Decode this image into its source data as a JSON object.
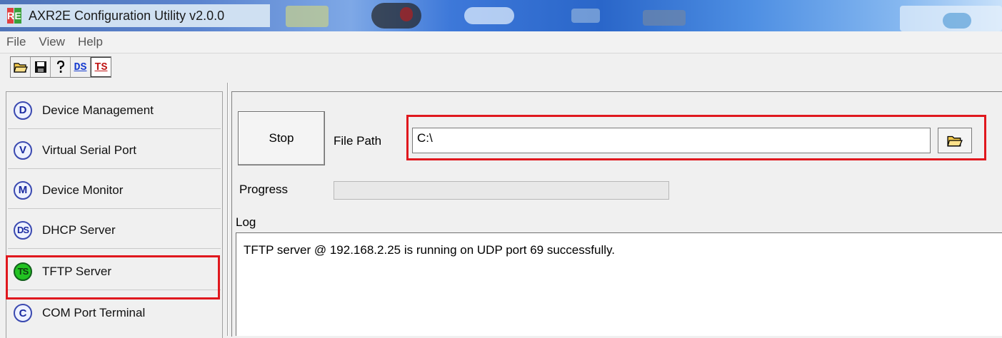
{
  "window": {
    "title": "AXR2E Configuration Utility v2.0.0",
    "icon_letters": [
      "R",
      "E"
    ]
  },
  "menu": [
    "File",
    "View",
    "Help"
  ],
  "toolbar": {
    "buttons": [
      {
        "name": "open-icon"
      },
      {
        "name": "save-icon"
      },
      {
        "name": "help-icon"
      },
      {
        "name": "ds-button",
        "label": "DS"
      },
      {
        "name": "ts-button",
        "label": "TS"
      }
    ]
  },
  "sidebar": {
    "items": [
      {
        "badge": "D",
        "label": "Device Management"
      },
      {
        "badge": "V",
        "label": "Virtual Serial Port"
      },
      {
        "badge": "M",
        "label": "Device Monitor"
      },
      {
        "badge": "DS",
        "label": "DHCP Server"
      },
      {
        "badge": "TS",
        "label": "TFTP Server",
        "active": true
      },
      {
        "badge": "C",
        "label": "COM Port Terminal"
      }
    ]
  },
  "main": {
    "stop_label": "Stop",
    "file_path_label": "File Path",
    "file_path_value": "C:\\",
    "progress_label": "Progress",
    "progress_value": 0,
    "log_label": "Log",
    "log_lines": [
      "TFTP server @ 192.168.2.25 is running on UDP port 69 successfully."
    ]
  },
  "colors": {
    "highlight": "#e0181e",
    "active_badge": "#22c322",
    "badge_border": "#3a49b0",
    "ds_text": "#1a3fd0",
    "ts_text": "#c01818"
  }
}
